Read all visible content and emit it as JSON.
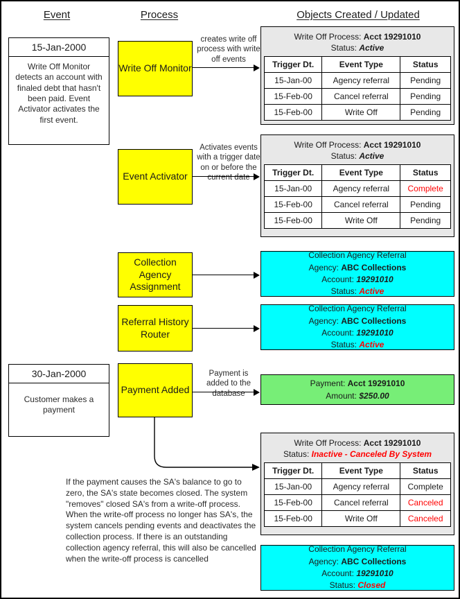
{
  "headers": {
    "event": "Event",
    "process": "Process",
    "objects": "Objects Created / Updated"
  },
  "events": [
    {
      "date": "15-Jan-2000",
      "description": "Write Off Monitor detects an account with finaled debt that hasn't been paid.  Event Activator activates the first event."
    },
    {
      "date": "30-Jan-2000",
      "description": "Customer makes a payment"
    }
  ],
  "processes": [
    {
      "label": "Write Off Monitor"
    },
    {
      "label": "Event Activator"
    },
    {
      "label": "Collection Agency Assignment"
    },
    {
      "label": "Referral History Router"
    },
    {
      "label": "Payment Added"
    }
  ],
  "connectors": [
    {
      "label": "creates write off process with write off events"
    },
    {
      "label": "Activates events with a trigger date on or before the current date"
    },
    {
      "label": ""
    },
    {
      "label": ""
    },
    {
      "label": "Payment is added to the database"
    }
  ],
  "table_columns": [
    "Trigger Dt.",
    "Event Type",
    "Status"
  ],
  "write_off_processes": [
    {
      "title_prefix": "Write Off Process: ",
      "account": "Acct 19291010",
      "status_label": "Status: ",
      "status_value": "Active",
      "status_color": "#1a1a1a",
      "rows": [
        {
          "trigger": "15-Jan-00",
          "event_type": "Agency referral",
          "status": "Pending",
          "status_red": false
        },
        {
          "trigger": "15-Feb-00",
          "event_type": "Cancel referral",
          "status": "Pending",
          "status_red": false
        },
        {
          "trigger": "15-Feb-00",
          "event_type": "Write Off",
          "status": "Pending",
          "status_red": false
        }
      ]
    },
    {
      "title_prefix": "Write Off Process: ",
      "account": "Acct 19291010",
      "status_label": "Status: ",
      "status_value": "Active",
      "status_color": "#1a1a1a",
      "rows": [
        {
          "trigger": "15-Jan-00",
          "event_type": "Agency referral",
          "status": "Complete",
          "status_red": true
        },
        {
          "trigger": "15-Feb-00",
          "event_type": "Cancel referral",
          "status": "Pending",
          "status_red": false
        },
        {
          "trigger": "15-Feb-00",
          "event_type": "Write Off",
          "status": "Pending",
          "status_red": false
        }
      ]
    },
    {
      "title_prefix": "Write Off Process: ",
      "account": "Acct 19291010",
      "status_label": "Status: ",
      "status_value": "Inactive - Canceled By System",
      "status_color": "#ff0000",
      "rows": [
        {
          "trigger": "15-Jan-00",
          "event_type": "Agency referral",
          "status": "Complete",
          "status_red": false
        },
        {
          "trigger": "15-Feb-00",
          "event_type": "Cancel referral",
          "status": "Canceled",
          "status_red": true
        },
        {
          "trigger": "15-Feb-00",
          "event_type": "Write Off",
          "status": "Canceled",
          "status_red": true
        }
      ]
    }
  ],
  "referrals": [
    {
      "title": "Collection Agency Referral",
      "agency_label": "Agency: ",
      "agency": "ABC Collections",
      "account_label": "Account: ",
      "account": "19291010",
      "status_label": "Status: ",
      "status": "Active"
    },
    {
      "title": "Collection Agency Referral",
      "agency_label": "Agency: ",
      "agency": "ABC Collections",
      "account_label": "Account: ",
      "account": "19291010",
      "status_label": "Status: ",
      "status": "Active"
    },
    {
      "title": "Collection Agency Referral",
      "agency_label": "Agency: ",
      "agency": "ABC Collections",
      "account_label": "Account: ",
      "account": "19291010",
      "status_label": "Status: ",
      "status": "Closed"
    }
  ],
  "payment": {
    "title_label": "Payment: ",
    "account": "Acct 19291010",
    "amount_label": "Amount: ",
    "amount": "$250.00"
  },
  "note": "If the payment causes the SA's balance to go to zero,  the SA's state becomes closed.  The system \"removes\" closed SA's from a write-off process.  When the write-off process no longer has SA's, the system cancels pending events and deactivates the collection process.  If there is an outstanding collection agency referral, this will also be cancelled when the write-off process is cancelled",
  "colors": {
    "process_fill": "#ffff00",
    "panel_fill": "#e8e8e8",
    "referral_fill": "#00ffff",
    "payment_fill": "#77ee77",
    "alert": "#ff0000"
  }
}
